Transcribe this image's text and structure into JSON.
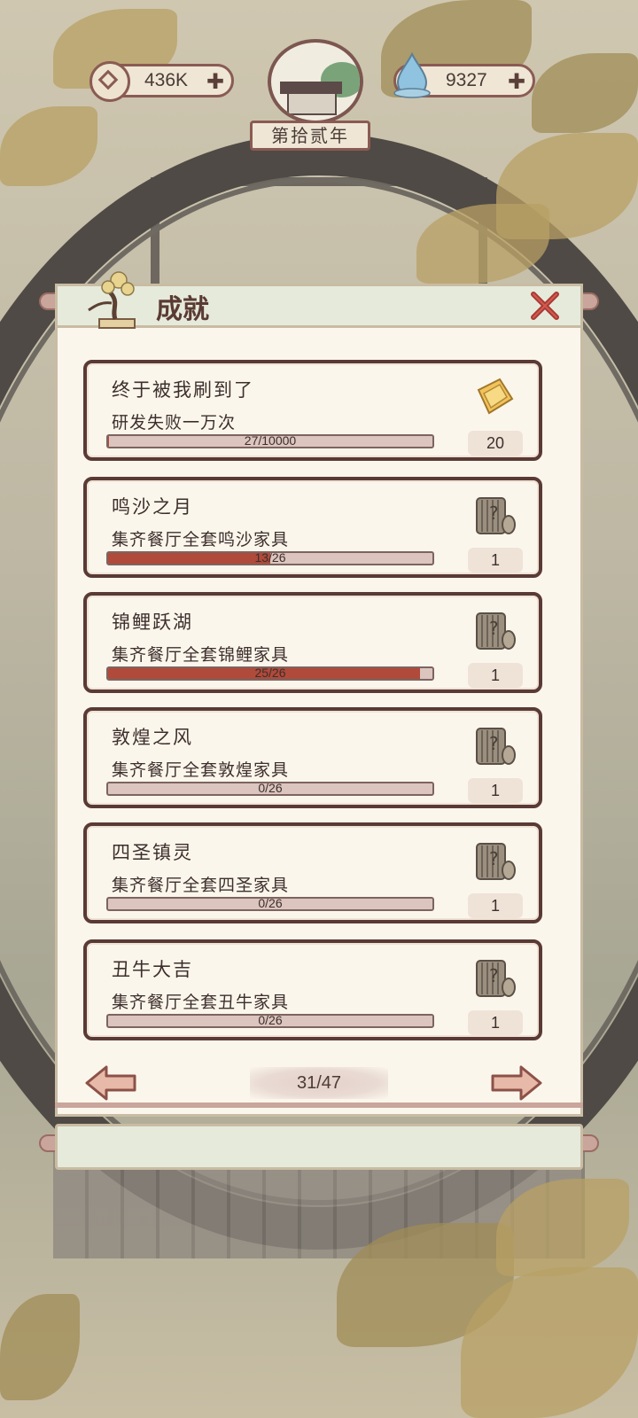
{
  "top_bar": {
    "coins": "436K",
    "spirit": "9327",
    "plus": "✚",
    "year": "第拾贰年"
  },
  "achievements": {
    "title": "成就",
    "items": [
      {
        "name": "终于被我刷到了",
        "desc": "研发失败一万次",
        "progress_text": "27/10000",
        "progress": 0.0027,
        "reward_icon": "gold-ticket-icon",
        "reward_count": "20"
      },
      {
        "name": "鸣沙之月",
        "desc": "集齐餐厅全套鸣沙家具",
        "progress_text": "13/26",
        "progress": 0.5,
        "reward_icon": "mystery-scroll-icon",
        "reward_count": "1"
      },
      {
        "name": "锦鲤跃湖",
        "desc": "集齐餐厅全套锦鲤家具",
        "progress_text": "25/26",
        "progress": 0.9615,
        "reward_icon": "mystery-scroll-icon",
        "reward_count": "1"
      },
      {
        "name": "敦煌之风",
        "desc": "集齐餐厅全套敦煌家具",
        "progress_text": "0/26",
        "progress": 0,
        "reward_icon": "mystery-scroll-icon",
        "reward_count": "1"
      },
      {
        "name": "四圣镇灵",
        "desc": "集齐餐厅全套四圣家具",
        "progress_text": "0/26",
        "progress": 0,
        "reward_icon": "mystery-scroll-icon",
        "reward_count": "1"
      },
      {
        "name": "丑牛大吉",
        "desc": "集齐餐厅全套丑牛家具",
        "progress_text": "0/26",
        "progress": 0,
        "reward_icon": "mystery-scroll-icon",
        "reward_count": "1"
      }
    ]
  },
  "pager": {
    "page": "31/47"
  },
  "colors": {
    "accent": "#b04a3a",
    "card_border": "#5a3a35",
    "panel": "#fbf6ec"
  }
}
